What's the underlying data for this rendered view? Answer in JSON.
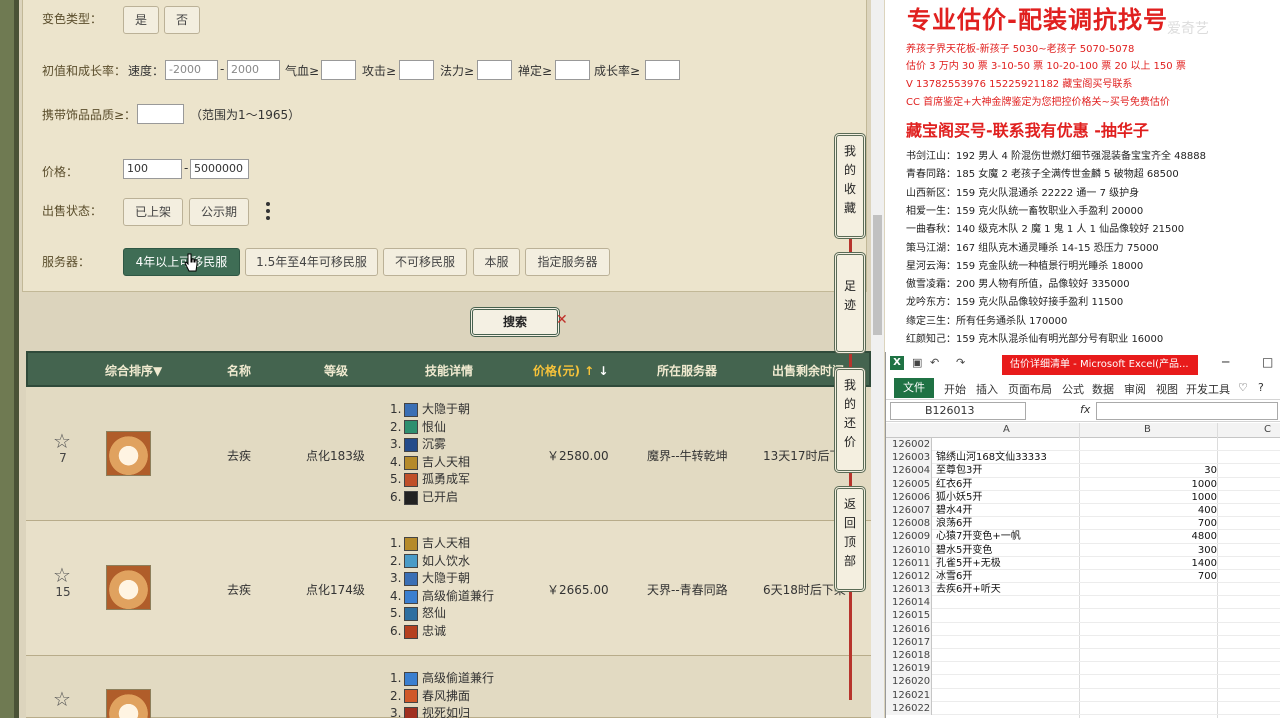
{
  "filters": {
    "color_type": {
      "label": "变色类型：",
      "options": [
        "是",
        "否"
      ]
    },
    "growth": {
      "label": "初值和成长率：",
      "speed_label": "速度：",
      "speed_min_placeholder": "-2000",
      "speed_max_placeholder": "2000",
      "hp_label": "气血≥",
      "atk_label": "攻击≥",
      "mp_label": "法力≥",
      "def_label": "禅定≥",
      "grow_label": "成长率≥"
    },
    "accessory": {
      "label": "携带饰品品质≥：",
      "hint": "（范围为1～1965）"
    },
    "price": {
      "label": "价格：",
      "min": "100",
      "max": "5000000"
    },
    "sale_status": {
      "label": "出售状态：",
      "options": [
        "已上架",
        "公示期"
      ]
    },
    "server": {
      "label": "服务器：",
      "options": [
        "4年以上可移民服",
        "1.5年至4年可移民服",
        "不可移民服",
        "本服",
        "指定服务器"
      ],
      "selected": 0
    },
    "search_label": "搜索"
  },
  "table": {
    "headers": [
      "综合排序▼",
      "名称",
      "等级",
      "技能详情",
      "价格(元)",
      "所在服务器",
      "出售剩余时间"
    ],
    "rows": [
      {
        "rank": "7",
        "name": "去疾",
        "level": "点化183级",
        "price": "￥2580.00",
        "server": "魔界--牛转乾坤",
        "time": "13天17时后下架",
        "skills": [
          {
            "n": "1.",
            "name": "大隐于朝",
            "color": "#3a6fb5"
          },
          {
            "n": "2.",
            "name": "恨仙",
            "color": "#2e8f6f"
          },
          {
            "n": "3.",
            "name": "沉雾",
            "color": "#244b8a"
          },
          {
            "n": "4.",
            "name": "吉人天相",
            "color": "#b58a2a"
          },
          {
            "n": "5.",
            "name": "孤勇成军",
            "color": "#c0502a"
          },
          {
            "n": "6.",
            "name": "已开启",
            "color": "#222222"
          }
        ]
      },
      {
        "rank": "15",
        "name": "去疾",
        "level": "点化174级",
        "price": "￥2665.00",
        "server": "天界--青春同路",
        "time": "6天18时后下架",
        "skills": [
          {
            "n": "1.",
            "name": "吉人天相",
            "color": "#b58a2a"
          },
          {
            "n": "2.",
            "name": "如人饮水",
            "color": "#4a9bc7"
          },
          {
            "n": "3.",
            "name": "大隐于朝",
            "color": "#3a6fb5"
          },
          {
            "n": "4.",
            "name": "高级偷道兼行",
            "color": "#3a7fd0"
          },
          {
            "n": "5.",
            "name": "怒仙",
            "color": "#2e6fa0"
          },
          {
            "n": "6.",
            "name": "忠诚",
            "color": "#b5401f"
          }
        ]
      },
      {
        "rank": "",
        "name": "",
        "level": "",
        "price": "",
        "server": "",
        "time": "",
        "skills": [
          {
            "n": "1.",
            "name": "高级偷道兼行",
            "color": "#3a7fd0"
          },
          {
            "n": "2.",
            "name": "春风拂面",
            "color": "#d0582a"
          },
          {
            "n": "3.",
            "name": "视死如归",
            "color": "#a03020"
          }
        ]
      }
    ]
  },
  "side_buttons": [
    "我的收藏",
    "足迹",
    "我的还价",
    "返回顶部"
  ],
  "promo": {
    "title": "专业估价-配装调抗找号",
    "watermark": "爱奇艺",
    "lines_red": [
      "养孩子界天花板-新孩子 5030~老孩子 5070-5078",
      "估价 3 万内 30 票    3-10-50 票    10-20-100 票    20 以上 150 票",
      "V 13782553976     15225921182   藏宝阁买号联系",
      "CC 首席鉴定+大神金牌鉴定为您把控价格关~买号免费估价"
    ],
    "subtitle": "藏宝阁买号-联系我有优惠 -抽华子",
    "list": [
      "书剑江山：192 男人 4 阶混伤世燃灯细节强混装备宝宝齐全 48888",
      "青春同路：185 女魔 2 老孩子全满传世金麟 5 破物超 68500",
      "山西新区：159 克火队混通杀 22222 通一 7 级护身",
      "相爱一生：159 克火队统一畜牧职业入手盈利 20000",
      "一曲春秋：140 级克木队 2 魔 1 鬼 1 人 1 仙品像较好 21500",
      "策马江湖：167 组队克木通灵睡杀 14-15 恐压力 75000",
      "星河云海：159 克金队统一种植景行明光睡杀 18000",
      "傲雪凌霜：200 男人物有所值，品像较好 335000",
      "龙吟东方：159 克火队品像较好接手盈利 11500",
      "缘定三生：所有任务通杀队 170000",
      "红颜知己：159 克木队混杀仙有明光部分号有职业 16000"
    ]
  },
  "excel": {
    "title": "估价详细清单 - Microsoft Excel(产品...",
    "tabs": [
      "开始",
      "插入",
      "页面布局",
      "公式",
      "数据",
      "审阅",
      "视图",
      "开发工具"
    ],
    "file_tab": "文件",
    "namebox": "B126013",
    "fx": "fx",
    "cols": [
      "A",
      "B",
      "C"
    ],
    "rows": [
      {
        "n": "126002",
        "a": "",
        "b": ""
      },
      {
        "n": "126003",
        "a": "锦绣山河168文仙33333",
        "b": ""
      },
      {
        "n": "126004",
        "a": "至尊包3开",
        "b": "30"
      },
      {
        "n": "126005",
        "a": "红衣6开",
        "b": "1000"
      },
      {
        "n": "126006",
        "a": "狐小妖5开",
        "b": "1000"
      },
      {
        "n": "126007",
        "a": "碧水4开",
        "b": "400"
      },
      {
        "n": "126008",
        "a": "浪荡6开",
        "b": "700"
      },
      {
        "n": "126009",
        "a": "心猿7开变色+一帆",
        "b": "4800"
      },
      {
        "n": "126010",
        "a": "碧水5开变色",
        "b": "300"
      },
      {
        "n": "126011",
        "a": "孔雀5开+无极",
        "b": "1400"
      },
      {
        "n": "126012",
        "a": "冰雪6开",
        "b": "700"
      },
      {
        "n": "126013",
        "a": "去疾6开+听天",
        "b": ""
      },
      {
        "n": "126014",
        "a": "",
        "b": ""
      },
      {
        "n": "126015",
        "a": "",
        "b": ""
      },
      {
        "n": "126016",
        "a": "",
        "b": ""
      },
      {
        "n": "126017",
        "a": "",
        "b": ""
      },
      {
        "n": "126018",
        "a": "",
        "b": ""
      },
      {
        "n": "126019",
        "a": "",
        "b": ""
      },
      {
        "n": "126020",
        "a": "",
        "b": ""
      },
      {
        "n": "126021",
        "a": "",
        "b": ""
      },
      {
        "n": "126022",
        "a": "",
        "b": ""
      }
    ]
  }
}
